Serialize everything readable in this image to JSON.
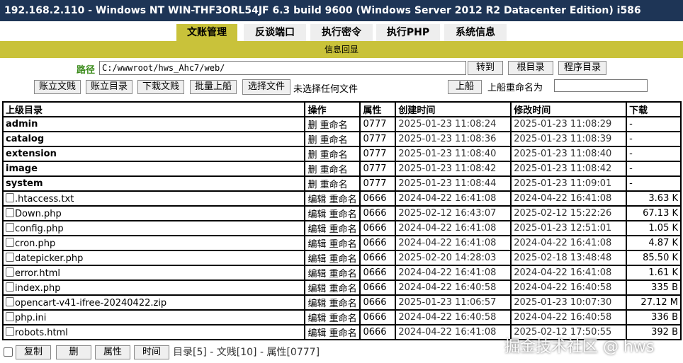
{
  "title": "192.168.2.110 - Windows NT WIN-THF3ORL54JF 6.3 build 9600 (Windows Server 2012 R2 Datacenter Edition) i586",
  "tabs": [
    "文账管理",
    "反谈端口",
    "执行密令",
    "执行PHP",
    "系统信息"
  ],
  "active_tab": 0,
  "info_label": "信息回显",
  "path": {
    "label": "路径",
    "value": "C:/wwwroot/hws_Ahc7/web/",
    "go_button": "转到",
    "root_button": "根目录",
    "program_button": "程序目录"
  },
  "toolbar": {
    "new_file": "账立文贱",
    "new_dir": "账立目录",
    "download": "下栽文贱",
    "batch_upload": "批量上船",
    "choose_file": "选择文件",
    "no_file": "未选择任何文件",
    "upload": "上船",
    "rename_label": "上船重命名为",
    "rename_value": ""
  },
  "table": {
    "headers": [
      "上级目录",
      "操作",
      "属性",
      "创建时间",
      "修改时间",
      "下载"
    ],
    "dirs": [
      {
        "name": "admin",
        "ops": "删 重命名",
        "attr": "0777",
        "created": "2025-01-23 11:08:24",
        "modified": "2025-01-23 11:08:29",
        "size": "-"
      },
      {
        "name": "catalog",
        "ops": "删 重命名",
        "attr": "0777",
        "created": "2025-01-23 11:08:36",
        "modified": "2025-01-23 11:08:39",
        "size": "-"
      },
      {
        "name": "extension",
        "ops": "删 重命名",
        "attr": "0777",
        "created": "2025-01-23 11:08:40",
        "modified": "2025-01-23 11:08:40",
        "size": "-"
      },
      {
        "name": "image",
        "ops": "删 重命名",
        "attr": "0777",
        "created": "2025-01-23 11:08:42",
        "modified": "2025-01-23 11:08:42",
        "size": "-"
      },
      {
        "name": "system",
        "ops": "删 重命名",
        "attr": "0777",
        "created": "2025-01-23 11:08:44",
        "modified": "2025-01-23 11:09:01",
        "size": "-"
      }
    ],
    "files": [
      {
        "name": ".htaccess.txt",
        "ops": "编辑 重命名",
        "attr": "0666",
        "created": "2024-04-22 16:41:08",
        "modified": "2024-04-22 16:41:08",
        "size": "3.63 K"
      },
      {
        "name": "Down.php",
        "ops": "编辑 重命名",
        "attr": "0666",
        "created": "2025-02-12 16:43:07",
        "modified": "2025-02-12 15:22:26",
        "size": "67.13 K"
      },
      {
        "name": "config.php",
        "ops": "编辑 重命名",
        "attr": "0666",
        "created": "2024-04-22 16:41:08",
        "modified": "2025-01-23 12:51:01",
        "size": "1.05 K"
      },
      {
        "name": "cron.php",
        "ops": "编辑 重命名",
        "attr": "0666",
        "created": "2024-04-22 16:41:08",
        "modified": "2024-04-22 16:41:08",
        "size": "4.87 K"
      },
      {
        "name": "datepicker.php",
        "ops": "编辑 重命名",
        "attr": "0666",
        "created": "2025-02-20 14:28:03",
        "modified": "2025-02-18 13:48:48",
        "size": "85.50 K"
      },
      {
        "name": "error.html",
        "ops": "编辑 重命名",
        "attr": "0666",
        "created": "2024-04-22 16:41:08",
        "modified": "2024-04-22 16:41:08",
        "size": "1.61 K"
      },
      {
        "name": "index.php",
        "ops": "编辑 重命名",
        "attr": "0666",
        "created": "2024-04-22 16:40:58",
        "modified": "2024-04-22 16:40:58",
        "size": "335 B"
      },
      {
        "name": "opencart-v41-ifree-20240422.zip",
        "ops": "编辑 重命名",
        "attr": "0666",
        "created": "2025-01-23 11:06:57",
        "modified": "2025-01-23 10:07:30",
        "size": "27.12 M"
      },
      {
        "name": "php.ini",
        "ops": "编辑 重命名",
        "attr": "0666",
        "created": "2024-04-22 16:40:58",
        "modified": "2024-04-22 16:40:58",
        "size": "336 B"
      },
      {
        "name": "robots.html",
        "ops": "编辑 重命名",
        "attr": "0666",
        "created": "2024-04-22 16:41:08",
        "modified": "2025-02-12 17:50:55",
        "size": "392 B"
      }
    ]
  },
  "bottom": {
    "copy": "复制",
    "delete": "删",
    "attr": "属性",
    "time": "时间",
    "summary": "目录[5] - 文贱[10] - 属性[0777]"
  },
  "watermark": "掘金技术社区 @ hws"
}
